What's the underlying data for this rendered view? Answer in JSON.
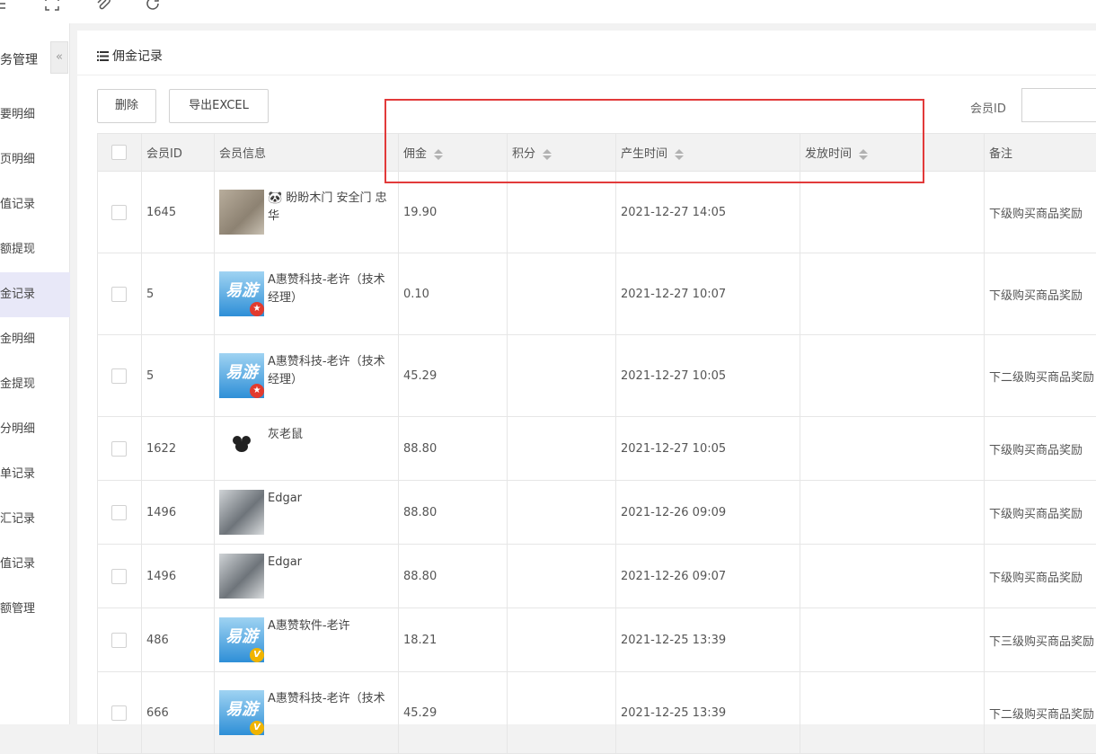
{
  "sidebar": {
    "title": "务管理",
    "collapse_icon": "«",
    "items": [
      {
        "label": "要明细"
      },
      {
        "label": "页明细"
      },
      {
        "label": "值记录"
      },
      {
        "label": "额提现"
      },
      {
        "label": "金记录"
      },
      {
        "label": "金明细"
      },
      {
        "label": "金提现"
      },
      {
        "label": "分明细"
      },
      {
        "label": "单记录"
      },
      {
        "label": "汇记录"
      },
      {
        "label": "值记录"
      },
      {
        "label": "额管理"
      }
    ],
    "active_index": 4
  },
  "panel": {
    "title": "佣金记录",
    "delete_label": "删除",
    "export_label": "导出EXCEL",
    "member_id_label": "会员ID",
    "member_id_value": ""
  },
  "table": {
    "headers": {
      "member_id": "会员ID",
      "member_info": "会员信息",
      "commission": "佣金",
      "points": "积分",
      "created_time": "产生时间",
      "issued_time": "发放时间",
      "remark": "备注"
    },
    "rows": [
      {
        "member_id": "1645",
        "info": "🐼 盼盼木门 安全门 忠华",
        "commission": "19.90",
        "points": "",
        "created_time": "2021-12-27 14:05",
        "issued_time": "",
        "remark": "下级购买商品奖励"
      },
      {
        "member_id": "5",
        "info": "A惠赞科技-老许（技术经理）",
        "commission": "0.10",
        "points": "",
        "created_time": "2021-12-27 10:07",
        "issued_time": "",
        "remark": "下级购买商品奖励"
      },
      {
        "member_id": "5",
        "info": "A惠赞科技-老许（技术经理）",
        "commission": "45.29",
        "points": "",
        "created_time": "2021-12-27 10:05",
        "issued_time": "",
        "remark": "下二级购买商品奖励"
      },
      {
        "member_id": "1622",
        "info": "灰老鼠",
        "commission": "88.80",
        "points": "",
        "created_time": "2021-12-27 10:05",
        "issued_time": "",
        "remark": "下级购买商品奖励"
      },
      {
        "member_id": "1496",
        "info": "Edgar",
        "commission": "88.80",
        "points": "",
        "created_time": "2021-12-26 09:09",
        "issued_time": "",
        "remark": "下级购买商品奖励"
      },
      {
        "member_id": "1496",
        "info": "Edgar",
        "commission": "88.80",
        "points": "",
        "created_time": "2021-12-26 09:07",
        "issued_time": "",
        "remark": "下级购买商品奖励"
      },
      {
        "member_id": "486",
        "info": "A惠赞软件-老许",
        "commission": "18.21",
        "points": "",
        "created_time": "2021-12-25 13:39",
        "issued_time": "",
        "remark": "下三级购买商品奖励"
      },
      {
        "member_id": "666",
        "info": "A惠赞科技-老许（技术",
        "commission": "45.29",
        "points": "",
        "created_time": "2021-12-25 13:39",
        "issued_time": "",
        "remark": "下二级购买商品奖励"
      }
    ]
  },
  "avatars": {
    "yiyou_text": "易游",
    "mouse_text": "灰老鼠",
    "badge_v": "V"
  },
  "colors": {
    "annotation_red": "#e23a3a",
    "active_bg": "#e8e8f8"
  }
}
